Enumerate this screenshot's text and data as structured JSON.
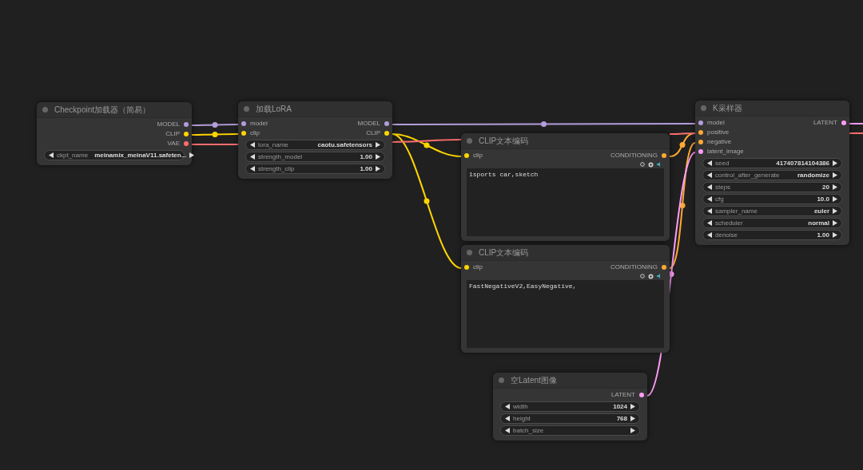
{
  "nodes": [
    {
      "title": "Checkpoint加载器（简易）",
      "outputs": [
        {
          "name": "MODEL",
          "color": "#b39ddb"
        },
        {
          "name": "CLIP",
          "color": "#ffd500"
        },
        {
          "name": "VAE",
          "color": "#ff6e6e"
        }
      ],
      "widgets": [
        {
          "name": "ckpt_name",
          "value": "meinamix_meinaV11.safeten..."
        }
      ]
    },
    {
      "title": "加载LoRA",
      "inputs": [
        {
          "name": "model",
          "color": "#b39ddb"
        },
        {
          "name": "clip",
          "color": "#ffd500"
        }
      ],
      "outputs": [
        {
          "name": "MODEL",
          "color": "#b39ddb"
        },
        {
          "name": "CLIP",
          "color": "#ffd500"
        }
      ],
      "widgets": [
        {
          "name": "lora_name",
          "value": "caotu.safetensors"
        },
        {
          "name": "strength_model",
          "value": "1.00"
        },
        {
          "name": "strength_clip",
          "value": "1.00"
        }
      ]
    },
    {
      "title": "CLIP文本编码",
      "inputs": [
        {
          "name": "clip",
          "color": "#ffd500"
        }
      ],
      "outputs": [
        {
          "name": "CONDITIONING",
          "color": "#ffa931"
        }
      ],
      "text": "1sports car,sketch"
    },
    {
      "title": "CLIP文本编码",
      "inputs": [
        {
          "name": "clip",
          "color": "#ffd500"
        }
      ],
      "outputs": [
        {
          "name": "CONDITIONING",
          "color": "#ffa931"
        }
      ],
      "text": "FastNegativeV2,EasyNegative,"
    },
    {
      "title": "K采样器",
      "inputs": [
        {
          "name": "model",
          "color": "#b39ddb"
        },
        {
          "name": "positive",
          "color": "#ffa931"
        },
        {
          "name": "negative",
          "color": "#ffa931"
        },
        {
          "name": "latent_image",
          "color": "#ff9cf9"
        }
      ],
      "outputs": [
        {
          "name": "LATENT",
          "color": "#ff9cf9"
        }
      ],
      "widgets": [
        {
          "name": "seed",
          "value": "417407814104386"
        },
        {
          "name": "control_after_generate",
          "value": "randomize"
        },
        {
          "name": "steps",
          "value": "20"
        },
        {
          "name": "cfg",
          "value": "10.0"
        },
        {
          "name": "sampler_name",
          "value": "euler"
        },
        {
          "name": "scheduler",
          "value": "normal"
        },
        {
          "name": "denoise",
          "value": "1.00"
        }
      ]
    },
    {
      "title": "空Latent图像",
      "outputs": [
        {
          "name": "LATENT",
          "color": "#ff9cf9"
        }
      ],
      "widgets": [
        {
          "name": "width",
          "value": "1024"
        },
        {
          "name": "height",
          "value": "768"
        },
        {
          "name": "batch_size"
        }
      ]
    }
  ]
}
